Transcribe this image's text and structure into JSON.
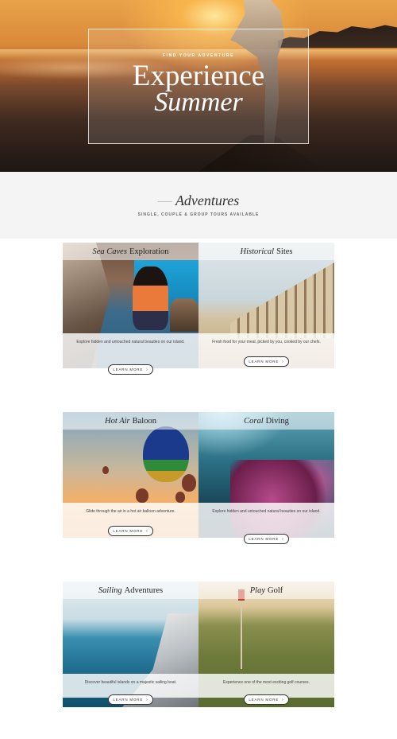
{
  "hero": {
    "kicker": "FIND YOUR ADVENTURE",
    "line1": "Experience",
    "line2": "Summer"
  },
  "section": {
    "dash": "—",
    "title": "Adventures",
    "subtitle": "SINGLE, COUPLE & GROUP TOURS AVAILABLE"
  },
  "cards": [
    {
      "title_em": "Sea Caves",
      "title_rest": "Exploration",
      "description": "Explore hidden and untouched natural beauties on our island.",
      "button": "LEARN MORE",
      "arrow": "›"
    },
    {
      "title_em": "Historical",
      "title_rest": "Sites",
      "description": "Fresh food for your meal, picked by you, cooked by our chefs.",
      "button": "LEARN MORE",
      "arrow": "›"
    },
    {
      "title_em": "Hot Air",
      "title_rest": "Baloon",
      "description": "Glide through the air in a hot air balloon adventure.",
      "button": "LEARN MORE",
      "arrow": "›"
    },
    {
      "title_em": "Coral",
      "title_rest": "Diving",
      "description": "Explore hidden and untouched natural beauties on our island.",
      "button": "LEARN MORE",
      "arrow": "›"
    },
    {
      "title_em": "Sailing",
      "title_rest": "Adventures",
      "description": "Discover beautiful islands on a majestic sailing boat.",
      "button": "LEARN MORE",
      "arrow": "›"
    },
    {
      "title_em": "Play",
      "title_rest": "Golf",
      "description": "Experience one of the most exciting golf courses.",
      "button": "LEARN MORE",
      "arrow": "›"
    }
  ]
}
